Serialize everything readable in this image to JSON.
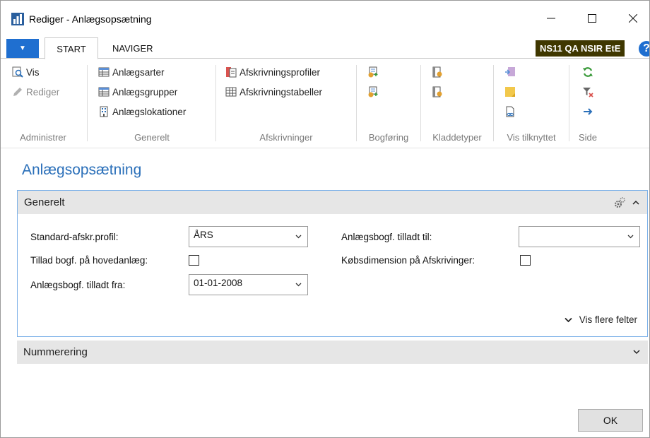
{
  "window": {
    "title": "Rediger - Anlægsopsætning",
    "controls": {
      "minimize": "—",
      "maximize": "☐",
      "close": "✕"
    }
  },
  "tabs": {
    "file_glyph": "▼",
    "start": "START",
    "navigate": "NAVIGER"
  },
  "company": "NS11 QA NSIR EtE",
  "help": "?",
  "ribbon": {
    "groups": [
      {
        "label": "Administrer",
        "items": [
          {
            "label": "Vis",
            "icon": "view-icon"
          },
          {
            "label": "Rediger",
            "icon": "edit-icon",
            "disabled": true
          }
        ]
      },
      {
        "label": "Generelt",
        "items": [
          {
            "label": "Anlægsarter",
            "icon": "table-icon"
          },
          {
            "label": "Anlægsgrupper",
            "icon": "table-icon"
          },
          {
            "label": "Anlægslokationer",
            "icon": "building-icon"
          }
        ]
      },
      {
        "label": "Afskrivninger",
        "items": [
          {
            "label": "Afskrivningsprofiler",
            "icon": "profile-icon"
          },
          {
            "label": "Afskrivningstabeller",
            "icon": "grid-icon"
          }
        ]
      },
      {
        "label": "Bogføring",
        "items": [
          {
            "icon": "posting-setup-icon"
          },
          {
            "icon": "posting-setup-icon"
          }
        ]
      },
      {
        "label": "Kladdetyper",
        "items": [
          {
            "icon": "journal-icon"
          },
          {
            "icon": "journal-icon"
          }
        ]
      },
      {
        "label": "Vis tilknyttet",
        "items": [
          {
            "icon": "onenote-icon"
          },
          {
            "icon": "notes-icon"
          },
          {
            "icon": "link-icon"
          }
        ]
      },
      {
        "label": "Side",
        "items": [
          {
            "icon": "refresh-icon"
          },
          {
            "icon": "clear-filter-icon"
          },
          {
            "icon": "goto-icon"
          }
        ]
      }
    ]
  },
  "page": {
    "title": "Anlægsopsætning"
  },
  "general": {
    "title": "Generelt",
    "fields": {
      "profile_label": "Standard-afskr.profil:",
      "profile_value": "ÅRS",
      "allow_main_label": "Tillad bogf. på hovedanlæg:",
      "allow_main_checked": false,
      "allowed_from_label": "Anlægsbogf. tilladt fra:",
      "allowed_from_value": "01-01-2008",
      "allowed_to_label": "Anlægsbogf. tilladt til:",
      "allowed_to_value": "",
      "purchase_dim_label": "Købsdimension på Afskrivinger:",
      "purchase_dim_checked": false
    },
    "more_fields": "Vis flere felter"
  },
  "numbering": {
    "title": "Nummerering"
  },
  "ok": "OK",
  "colors": {
    "accent": "#1f6fd0",
    "title_blue": "#2a6fb9",
    "company_bg": "#3f3700",
    "panel_border": "#7bb0e8"
  }
}
